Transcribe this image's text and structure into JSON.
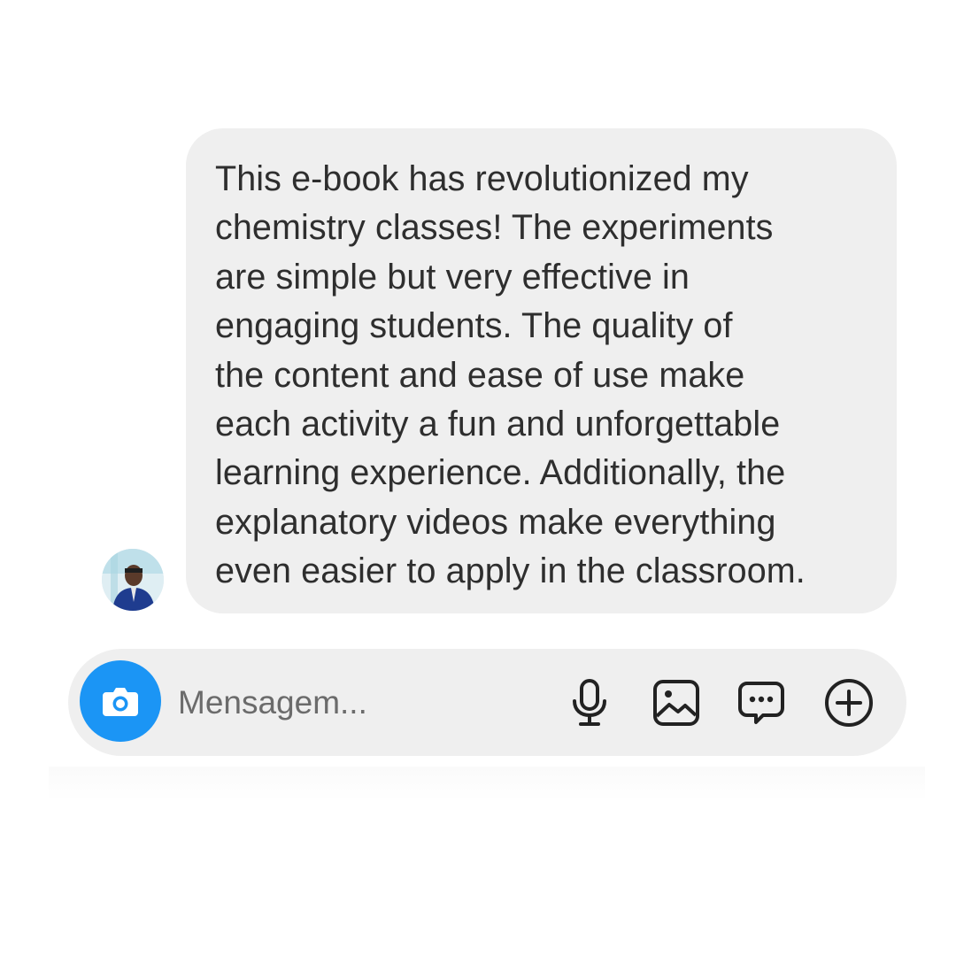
{
  "message": {
    "text": "This e-book has revolutionized my\nchemistry classes! The experiments\nare simple but very effective in\nengaging students. The quality of\nthe content and ease of use make\neach activity a fun and unforgettable\nlearning experience. Additionally, the\nexplanatory videos make everything\neven easier to apply in the classroom."
  },
  "composer": {
    "placeholder": "Mensagem..."
  },
  "icons": {
    "camera": "camera-icon",
    "microphone": "microphone-icon",
    "gallery": "image-gallery-icon",
    "sticker": "chat-bubble-icon",
    "plus": "plus-circle-icon"
  },
  "colors": {
    "camera_button": "#1b95f5",
    "bubble_background": "#efefef",
    "text": "#2e2e2e"
  }
}
